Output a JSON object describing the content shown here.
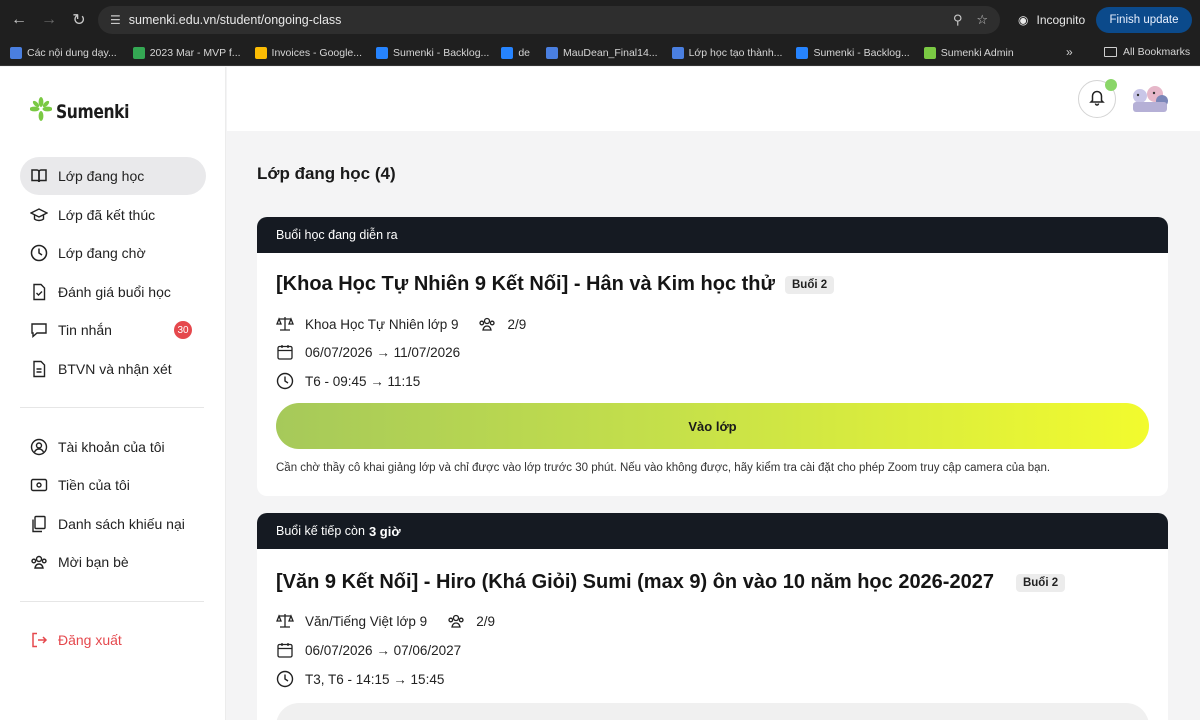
{
  "browser": {
    "url": "sumenki.edu.vn/student/ongoing-class",
    "incognito_label": "Incognito",
    "finish_update_label": "Finish update",
    "bookmarks": [
      {
        "label": "Các nội dung dạy...",
        "color": "#4a7fe0"
      },
      {
        "label": "2023 Mar - MVP f...",
        "color": "#34a853"
      },
      {
        "label": "Invoices - Google...",
        "color": "#fbbc04"
      },
      {
        "label": "Sumenki - Backlog...",
        "color": "#2684ff"
      },
      {
        "label": "de",
        "color": "#2684ff"
      },
      {
        "label": "MauDean_Final14...",
        "color": "#4a7fe0"
      },
      {
        "label": "Lớp học tạo thành...",
        "color": "#4a7fe0"
      },
      {
        "label": "Sumenki - Backlog...",
        "color": "#2684ff"
      },
      {
        "label": "Sumenki Admin",
        "color": "#7ac943"
      }
    ],
    "more_label": "»",
    "all_bookmarks_label": "All Bookmarks"
  },
  "app": {
    "logo_text": "Sumenki",
    "nav": [
      {
        "label": "Lớp đang học",
        "icon": "book-open-icon",
        "active": true
      },
      {
        "label": "Lớp đã kết thúc",
        "icon": "graduation-cap-icon"
      },
      {
        "label": "Lớp đang chờ",
        "icon": "clock-icon"
      },
      {
        "label": "Đánh giá buổi học",
        "icon": "file-check-icon"
      },
      {
        "label": "Tin nhắn",
        "icon": "message-icon",
        "badge": "30"
      },
      {
        "label": "BTVN và nhận xét",
        "icon": "file-text-icon"
      }
    ],
    "nav_account": [
      {
        "label": "Tài khoản của tôi",
        "icon": "user-circle-icon"
      },
      {
        "label": "Tiền của tôi",
        "icon": "wallet-icon"
      },
      {
        "label": "Danh sách khiếu nại",
        "icon": "clipboard-icon"
      },
      {
        "label": "Mời bạn bè",
        "icon": "users-icon"
      }
    ],
    "logout_label": "Đăng xuất",
    "page_title": "Lớp đang học (4)",
    "cards": [
      {
        "header": "Buổi học đang diễn ra",
        "title": "[Khoa Học Tự Nhiên 9 Kết Nối] - Hân và Kim học thử",
        "session": "Buổi 2",
        "subject": "Khoa Học Tự Nhiên lớp 9",
        "students": "2/9",
        "dates": "06/07/2026 → 11/07/2026",
        "schedule": "T6 - 09:45 → 11:15",
        "join_label": "Vào lớp",
        "note": "Cần chờ thầy cô khai giảng lớp và chỉ được vào lớp trước 30 phút. Nếu vào không được, hãy kiểm tra cài đặt cho phép Zoom truy cập camera của bạn."
      },
      {
        "header_prefix": "Buổi kế tiếp còn",
        "header_emph": "3 giờ",
        "title": "[Văn 9 Kết Nối] - Hiro (Khá Giỏi) Sumi (max 9) ôn vào 10 năm học 2026-2027",
        "session": "Buổi 2",
        "subject": "Văn/Tiếng Việt lớp 9",
        "students": "2/9",
        "dates": "06/07/2026 → 07/06/2027",
        "schedule": "T3, T6 - 14:15 → 15:45"
      }
    ]
  }
}
